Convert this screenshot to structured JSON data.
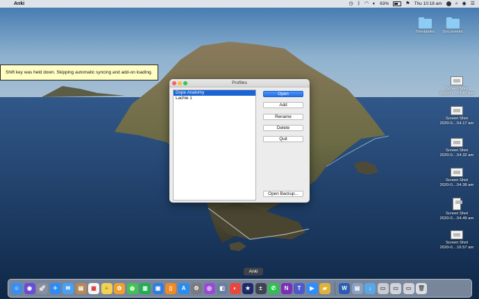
{
  "menubar": {
    "apple_glyph": "",
    "app_name": "Anki",
    "battery_percent": "63%",
    "clock": "Thu 10:18 am"
  },
  "tooltip": {
    "text": "Shift key was held down. Skipping automatic syncing and add-on loading."
  },
  "dialog": {
    "title": "Profiles",
    "profiles": [
      {
        "label": "Dope Anatomy",
        "selected": true
      },
      {
        "label": "Lachie 1",
        "selected": false
      }
    ],
    "buttons": {
      "open": "Open",
      "add": "Add",
      "rename": "Rename",
      "delete": "Delete",
      "quit": "Quit",
      "open_backup": "Open Backup..."
    }
  },
  "desktop": {
    "folders": [
      {
        "label": "Timetables"
      },
      {
        "label": "Documents"
      }
    ],
    "files": [
      {
        "line1": "Screen Shot",
        "line2": "2020-0....53.47 am"
      },
      {
        "line1": "Screen Shot",
        "line2": "2020-0....54.17 am"
      },
      {
        "line1": "Screen Shot",
        "line2": "2020-0....54.32 am"
      },
      {
        "line1": "Screen Shot",
        "line2": "2020-0....54.38 am"
      },
      {
        "line1": "Screen Shot",
        "line2": "2020-0....54.49 am"
      },
      {
        "line1": "Screen Shot",
        "line2": "2020-0....16.57 am"
      }
    ]
  },
  "dock": {
    "hover_label": "Anki",
    "apps": [
      {
        "icon": "finder-icon",
        "color": "#3a8ef0"
      },
      {
        "icon": "siri-icon",
        "color": "#6a4cd6"
      },
      {
        "icon": "launchpad-icon",
        "color": "#8a8fa0"
      },
      {
        "icon": "safari-icon",
        "color": "#2f8cf2"
      },
      {
        "icon": "mail-icon",
        "color": "#4aa0f0"
      },
      {
        "icon": "notes-folder-icon",
        "color": "#b58a52"
      },
      {
        "icon": "calendar-icon",
        "color": "#f6f6f6"
      },
      {
        "icon": "notes-icon",
        "color": "#f4d24e"
      },
      {
        "icon": "photos-icon",
        "color": "#f0a030"
      },
      {
        "icon": "messages-icon",
        "color": "#3ec44f"
      },
      {
        "icon": "numbers-icon",
        "color": "#1fae50"
      },
      {
        "icon": "keynote-icon",
        "color": "#2f7de0"
      },
      {
        "icon": "books-icon",
        "color": "#f08a24"
      },
      {
        "icon": "app-store-icon",
        "color": "#2b8cf0"
      },
      {
        "icon": "system-preferences-icon",
        "color": "#7a7a80"
      },
      {
        "icon": "podcasts-icon",
        "color": "#9a4ad6"
      },
      {
        "icon": "preview-icon",
        "color": "#6a7fa0"
      },
      {
        "icon": "chrome-icon",
        "color": "#e9473b"
      },
      {
        "icon": "anki-icon",
        "color": "#1c2a66"
      },
      {
        "icon": "calculator-icon",
        "color": "#3d4450"
      },
      {
        "icon": "whatsapp-icon",
        "color": "#2fc150"
      },
      {
        "icon": "onenote-icon",
        "color": "#7b2fb4"
      },
      {
        "icon": "teams-icon",
        "color": "#5059c9"
      },
      {
        "icon": "zoom-icon",
        "color": "#2d8cff"
      },
      {
        "icon": "stickies-icon",
        "color": "#e0b23a"
      },
      {
        "icon": "word-icon",
        "color": "#2b5db3"
      },
      {
        "icon": "screenshot-stack-icon",
        "color": "#8aa0c0"
      },
      {
        "icon": "downloads-stack-icon",
        "color": "#5aa7e8"
      },
      {
        "icon": "trash-icon",
        "color": "#d9dde3"
      }
    ]
  }
}
